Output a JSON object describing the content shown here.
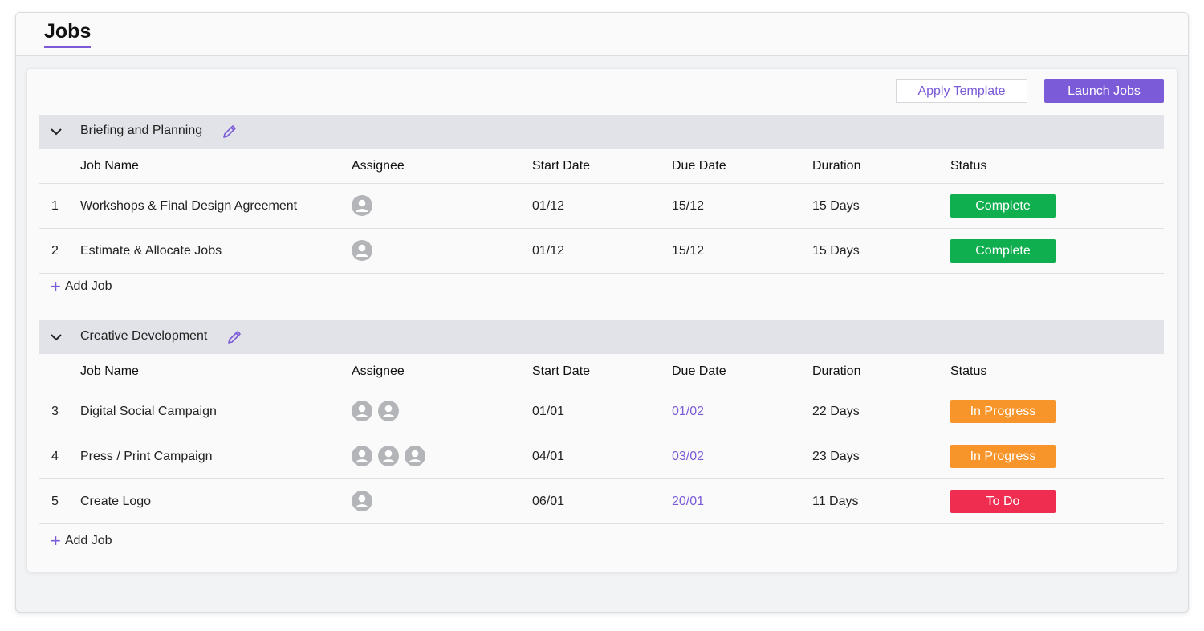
{
  "header": {
    "title": "Jobs"
  },
  "toolbar": {
    "apply_template": "Apply Template",
    "launch_jobs": "Launch Jobs"
  },
  "columns": {
    "job_name": "Job Name",
    "assignee": "Assignee",
    "start_date": "Start Date",
    "due_date": "Due Date",
    "duration": "Duration",
    "status": "Status"
  },
  "add_job_label": "Add Job",
  "colors": {
    "accent": "#7b5bd8",
    "complete": "#0fae4f",
    "in_progress": "#f7952a",
    "to_do": "#ee2d51"
  },
  "sections": [
    {
      "title": "Briefing and Planning",
      "jobs": [
        {
          "num": "1",
          "name": "Workshops & Final Design Agreement",
          "assignees": 1,
          "start": "01/12",
          "due": "15/12",
          "due_link": false,
          "duration": "15 Days",
          "status": "Complete",
          "status_color": "#0fae4f"
        },
        {
          "num": "2",
          "name": "Estimate & Allocate Jobs",
          "assignees": 1,
          "start": "01/12",
          "due": "15/12",
          "due_link": false,
          "duration": "15 Days",
          "status": "Complete",
          "status_color": "#0fae4f"
        }
      ]
    },
    {
      "title": "Creative Development",
      "jobs": [
        {
          "num": "3",
          "name": "Digital Social Campaign",
          "assignees": 2,
          "start": "01/01",
          "due": "01/02",
          "due_link": true,
          "duration": "22 Days",
          "status": "In Progress",
          "status_color": "#f7952a"
        },
        {
          "num": "4",
          "name": "Press / Print Campaign",
          "assignees": 3,
          "start": "04/01",
          "due": "03/02",
          "due_link": true,
          "duration": "23 Days",
          "status": "In Progress",
          "status_color": "#f7952a"
        },
        {
          "num": "5",
          "name": "Create Logo",
          "assignees": 1,
          "start": "06/01",
          "due": "20/01",
          "due_link": true,
          "duration": "11 Days",
          "status": "To Do",
          "status_color": "#ee2d51"
        }
      ]
    }
  ]
}
